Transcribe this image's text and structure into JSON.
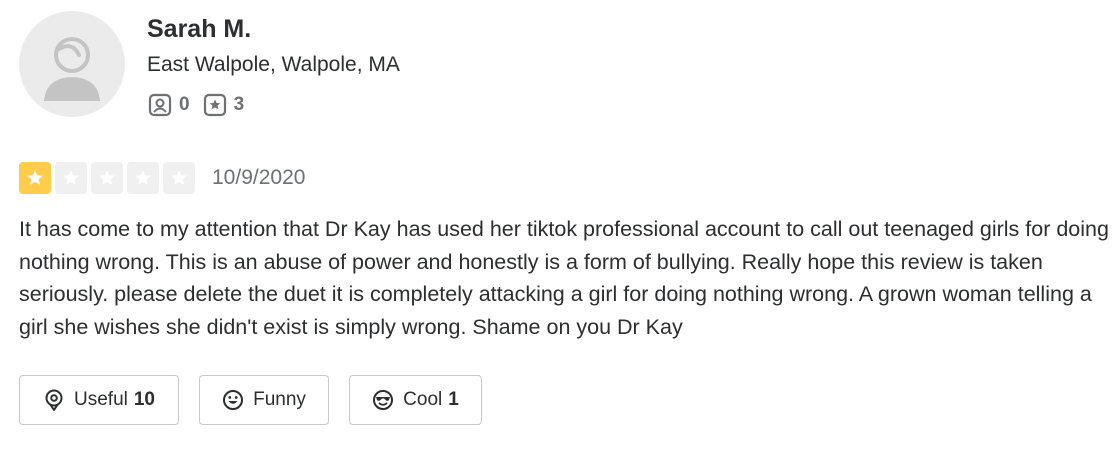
{
  "user": {
    "name": "Sarah M.",
    "location": "East Walpole, Walpole, MA",
    "friends_count": "0",
    "reviews_count": "3"
  },
  "review": {
    "rating": 1,
    "max_rating": 5,
    "date": "10/9/2020",
    "text": "It has come to my attention that Dr Kay has used her tiktok professional account to call out teenaged girls for doing nothing wrong. This is an abuse of power and honestly is a form of bullying. Really hope this review is taken seriously. please delete the duet it is completely attacking a girl for doing nothing wrong. A grown woman telling a girl she wishes she didn't exist is simply wrong. Shame on you Dr Kay"
  },
  "reactions": [
    {
      "label": "Useful",
      "count": "10",
      "icon": "lightbulb-icon"
    },
    {
      "label": "Funny",
      "count": "",
      "icon": "smile-icon"
    },
    {
      "label": "Cool",
      "count": "1",
      "icon": "sunglasses-icon"
    }
  ],
  "colors": {
    "star_filled": "#ffcc4b",
    "star_empty": "#f0f0f0",
    "text": "#2d2e2f",
    "muted": "#6e7072",
    "border": "#c8c9ca"
  }
}
